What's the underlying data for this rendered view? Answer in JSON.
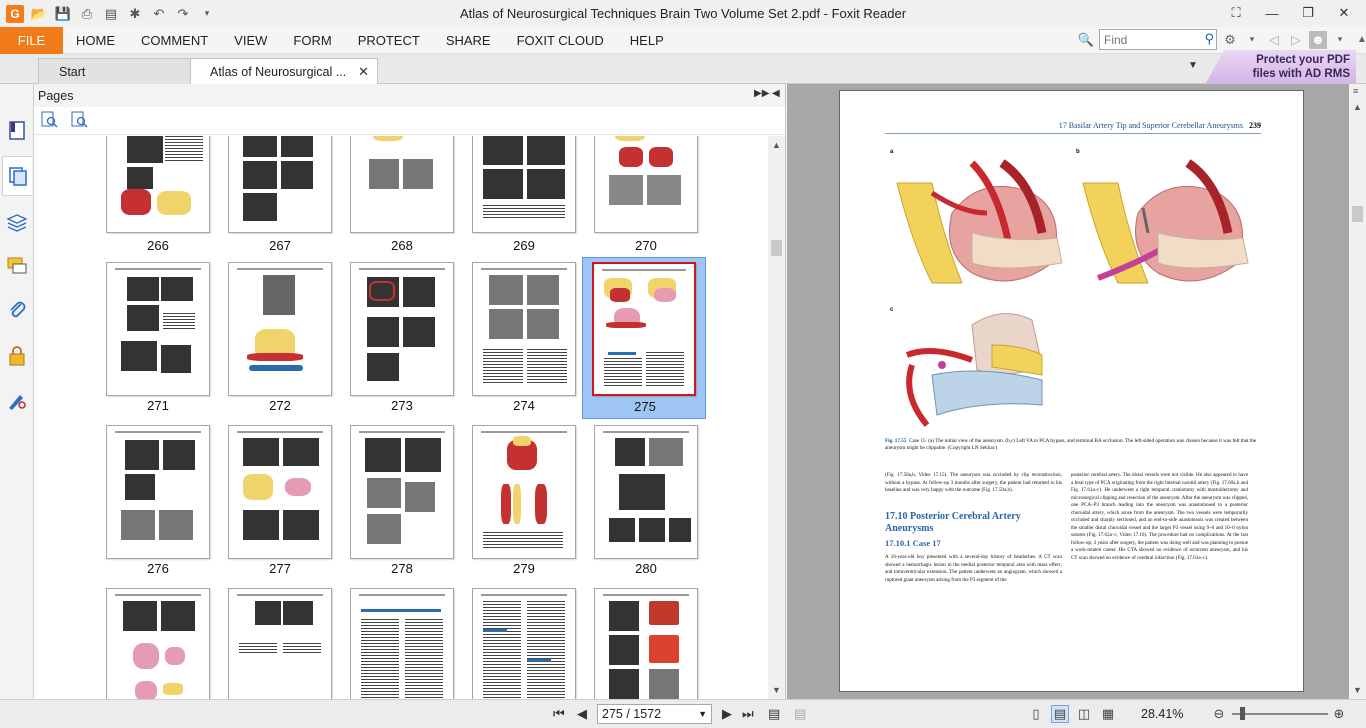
{
  "window": {
    "title": "Atlas of Neurosurgical Techniques Brain Two Volume Set 2.pdf - Foxit Reader"
  },
  "menu": {
    "file": "FILE",
    "items": [
      "HOME",
      "COMMENT",
      "VIEW",
      "FORM",
      "PROTECT",
      "SHARE",
      "FOXIT CLOUD",
      "HELP"
    ]
  },
  "search": {
    "placeholder": "Find"
  },
  "tabs": [
    {
      "label": "Start"
    },
    {
      "label": "Atlas of Neurosurgical ..."
    }
  ],
  "ad_banner": {
    "line1": "Protect your PDF",
    "line2": "files with AD RMS"
  },
  "pages_panel": {
    "title": "Pages",
    "thumbnails": [
      {
        "page": "266"
      },
      {
        "page": "267"
      },
      {
        "page": "268"
      },
      {
        "page": "269"
      },
      {
        "page": "270"
      },
      {
        "page": "271"
      },
      {
        "page": "272"
      },
      {
        "page": "273"
      },
      {
        "page": "274"
      },
      {
        "page": "275",
        "selected": true
      },
      {
        "page": "276"
      },
      {
        "page": "277"
      },
      {
        "page": "278"
      },
      {
        "page": "279"
      },
      {
        "page": "280"
      },
      {
        "page": ""
      },
      {
        "page": ""
      },
      {
        "page": ""
      },
      {
        "page": ""
      },
      {
        "page": ""
      }
    ]
  },
  "document": {
    "header_chapter": "17    Basilar Artery Tip and Superior Cerebellar Aneurysms",
    "header_page": "239",
    "fig_labels": [
      "a",
      "b",
      "c"
    ],
    "caption_bold": "Fig. 17.55",
    "caption_text": "Case 15. (a) The initial view of the aneurysm. (b,c) Left VA to PCA bypass, and terminal BA occlusion. The left-sided operation was chosen because it was felt that the aneurysm might be clippable. (Copyright LN Sekhar.)",
    "col1_top": "(Fig. 17.58a,b, Video 17.15). The aneurysm was occluded by clip reconstruction, without a bypass. At follow-up 3 months after surgery, the patient had returned to his baseline and was very happy with the outcome (Fig. 17.59a,b).",
    "section_title": "17.10  Posterior Cerebral Artery Aneurysms",
    "subsection_title": "17.10.1  Case 17",
    "col1_body": "A 16-year-old boy presented with a several-day history of headaches. A CT scan showed a hemorrhagic lesion in the medial posterior temporal area with mass effect, and intraventricular extension. The patient underwent an angiogram, which showed a ruptured giant aneurysm arising from the P3 segment of the",
    "col2_body": "posterior cerebral artery. The distal vessels were not visible. He also appeared to have a fetal type of PCA originating from the right internal carotid artery (Fig. 17.60a,b and Fig. 17.61a–c). He underwent a right temporal craniotomy with mastoidectomy and microsurgical clipping and resection of the aneurysm. After the aneurysm was clipped, one PCA–P3 branch leading into the aneurysm was anastomosed to a posterior choroidal artery, which arose from the aneurysm. The two vessels were temporarily occluded and sharply sectioned, and an end-to-side anastomosis was created between the smaller distal choroidal vessel and the larger P3 vessel using 9–0 and 10–0 nylon sutures (Fig. 17.62a–c, Video 17.16). The procedure had no complications. At the last follow-up, 3 years after surgery, the patient was doing well and was planning to pursue a work-related career. His CTA showed no evidence of recurrent aneurysm, and his CT scan showed no evidence of cerebral infarction (Fig. 17.63a–c)."
  },
  "status": {
    "page_display": "275 / 1572",
    "zoom": "28.41%"
  },
  "colors": {
    "file_tab": "#f07b18",
    "selection": "#9ec5f3",
    "selected_border": "#d0141c",
    "heading_blue": "#2a65a8"
  }
}
